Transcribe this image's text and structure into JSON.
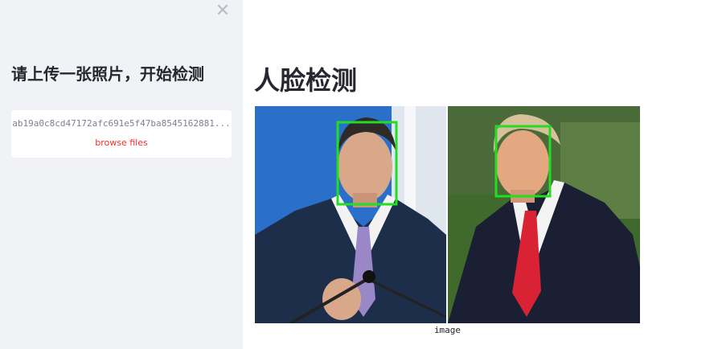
{
  "sidebar": {
    "close_icon": "close-icon",
    "title": "请上传一张照片，开始检测",
    "uploader": {
      "file_name": "ab19a0c8cd47172afc691e5f47ba8545162881...",
      "browse_label": "browse files"
    }
  },
  "main": {
    "title": "人脸检测",
    "image": {
      "caption": "image",
      "faces_detected": 2,
      "box_color": "#22dd22"
    }
  },
  "colors": {
    "sidebar_bg": "#f0f2f6",
    "accent": "#ff2b2b",
    "text": "#262730"
  }
}
